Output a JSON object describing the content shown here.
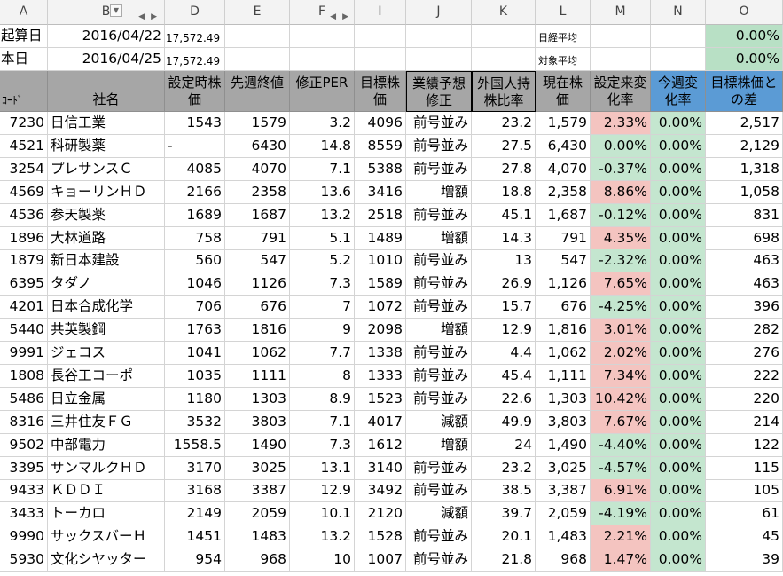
{
  "columns": [
    "A",
    "B",
    "D",
    "E",
    "F",
    "I",
    "J",
    "K",
    "L",
    "M",
    "N",
    "O"
  ],
  "top_rows": [
    {
      "label": "起算日",
      "date": "2016/04/22",
      "index_value": "17,572.49",
      "index_label": "日経平均",
      "change": "0.00%"
    },
    {
      "label": "本日",
      "date": "2016/04/25",
      "index_value": "17,572.49",
      "index_label": "対象平均",
      "change": "0.00%"
    }
  ],
  "headers": [
    "ｺｰﾄﾞ",
    "社名",
    "設定時株価",
    "先週終値",
    "修正PER",
    "目標株価",
    "業績予想修正",
    "外国人持株比率",
    "現在株価",
    "設定来変化率",
    "今週変化率",
    "目標株価との差"
  ],
  "rows": [
    [
      "7230",
      "日信工業",
      "1543",
      "1579",
      "3.2",
      "4096",
      "前号並み",
      "23.2",
      "1,579",
      "2.33%",
      "0.00%",
      "2,517"
    ],
    [
      "4521",
      "科研製薬",
      "-",
      "6430",
      "14.8",
      "8559",
      "前号並み",
      "27.5",
      "6,430",
      "0.00%",
      "0.00%",
      "2,129"
    ],
    [
      "3254",
      "プレサンスＣ",
      "4085",
      "4070",
      "7.1",
      "5388",
      "前号並み",
      "27.8",
      "4,070",
      "-0.37%",
      "0.00%",
      "1,318"
    ],
    [
      "4569",
      "キョーリンＨＤ",
      "2166",
      "2358",
      "13.6",
      "3416",
      "増額",
      "18.8",
      "2,358",
      "8.86%",
      "0.00%",
      "1,058"
    ],
    [
      "4536",
      "参天製薬",
      "1689",
      "1687",
      "13.2",
      "2518",
      "前号並み",
      "45.1",
      "1,687",
      "-0.12%",
      "0.00%",
      "831"
    ],
    [
      "1896",
      "大林道路",
      "758",
      "791",
      "5.1",
      "1489",
      "増額",
      "14.3",
      "791",
      "4.35%",
      "0.00%",
      "698"
    ],
    [
      "1879",
      "新日本建設",
      "560",
      "547",
      "5.2",
      "1010",
      "前号並み",
      "13",
      "547",
      "-2.32%",
      "0.00%",
      "463"
    ],
    [
      "6395",
      "タダノ",
      "1046",
      "1126",
      "7.3",
      "1589",
      "前号並み",
      "26.9",
      "1,126",
      "7.65%",
      "0.00%",
      "463"
    ],
    [
      "4201",
      "日本合成化学",
      "706",
      "676",
      "7",
      "1072",
      "前号並み",
      "15.7",
      "676",
      "-4.25%",
      "0.00%",
      "396"
    ],
    [
      "5440",
      "共英製鋼",
      "1763",
      "1816",
      "9",
      "2098",
      "増額",
      "12.9",
      "1,816",
      "3.01%",
      "0.00%",
      "282"
    ],
    [
      "9991",
      "ジェコス",
      "1041",
      "1062",
      "7.7",
      "1338",
      "前号並み",
      "4.4",
      "1,062",
      "2.02%",
      "0.00%",
      "276"
    ],
    [
      "1808",
      "長谷工コーポ",
      "1035",
      "1111",
      "8",
      "1333",
      "前号並み",
      "45.4",
      "1,111",
      "7.34%",
      "0.00%",
      "222"
    ],
    [
      "5486",
      "日立金属",
      "1180",
      "1303",
      "8.9",
      "1523",
      "前号並み",
      "22.6",
      "1,303",
      "10.42%",
      "0.00%",
      "220"
    ],
    [
      "8316",
      "三井住友ＦＧ",
      "3532",
      "3803",
      "7.1",
      "4017",
      "減額",
      "49.9",
      "3,803",
      "7.67%",
      "0.00%",
      "214"
    ],
    [
      "9502",
      "中部電力",
      "1558.5",
      "1490",
      "7.3",
      "1612",
      "増額",
      "24",
      "1,490",
      "-4.40%",
      "0.00%",
      "122"
    ],
    [
      "3395",
      "サンマルクＨＤ",
      "3170",
      "3025",
      "13.1",
      "3140",
      "前号並み",
      "23.2",
      "3,025",
      "-4.57%",
      "0.00%",
      "115"
    ],
    [
      "9433",
      "ＫＤＤＩ",
      "3168",
      "3387",
      "12.9",
      "3492",
      "前号並み",
      "38.5",
      "3,387",
      "6.91%",
      "0.00%",
      "105"
    ],
    [
      "3433",
      "トーカロ",
      "2149",
      "2059",
      "10.1",
      "2120",
      "減額",
      "39.7",
      "2,059",
      "-4.19%",
      "0.00%",
      "61"
    ],
    [
      "9990",
      "サックスバーＨ",
      "1451",
      "1483",
      "13.2",
      "1528",
      "前号並み",
      "20.1",
      "1,483",
      "2.21%",
      "0.00%",
      "45"
    ],
    [
      "5930",
      "文化シヤッター",
      "954",
      "968",
      "10",
      "1007",
      "前号並み",
      "21.8",
      "968",
      "1.47%",
      "0.00%",
      "39"
    ]
  ],
  "colors": {
    "header_gray": "#a6a6a6",
    "header_blue": "#5b9bd5",
    "positive_red": "#f4c4c0",
    "green": "#c4e6cf"
  }
}
